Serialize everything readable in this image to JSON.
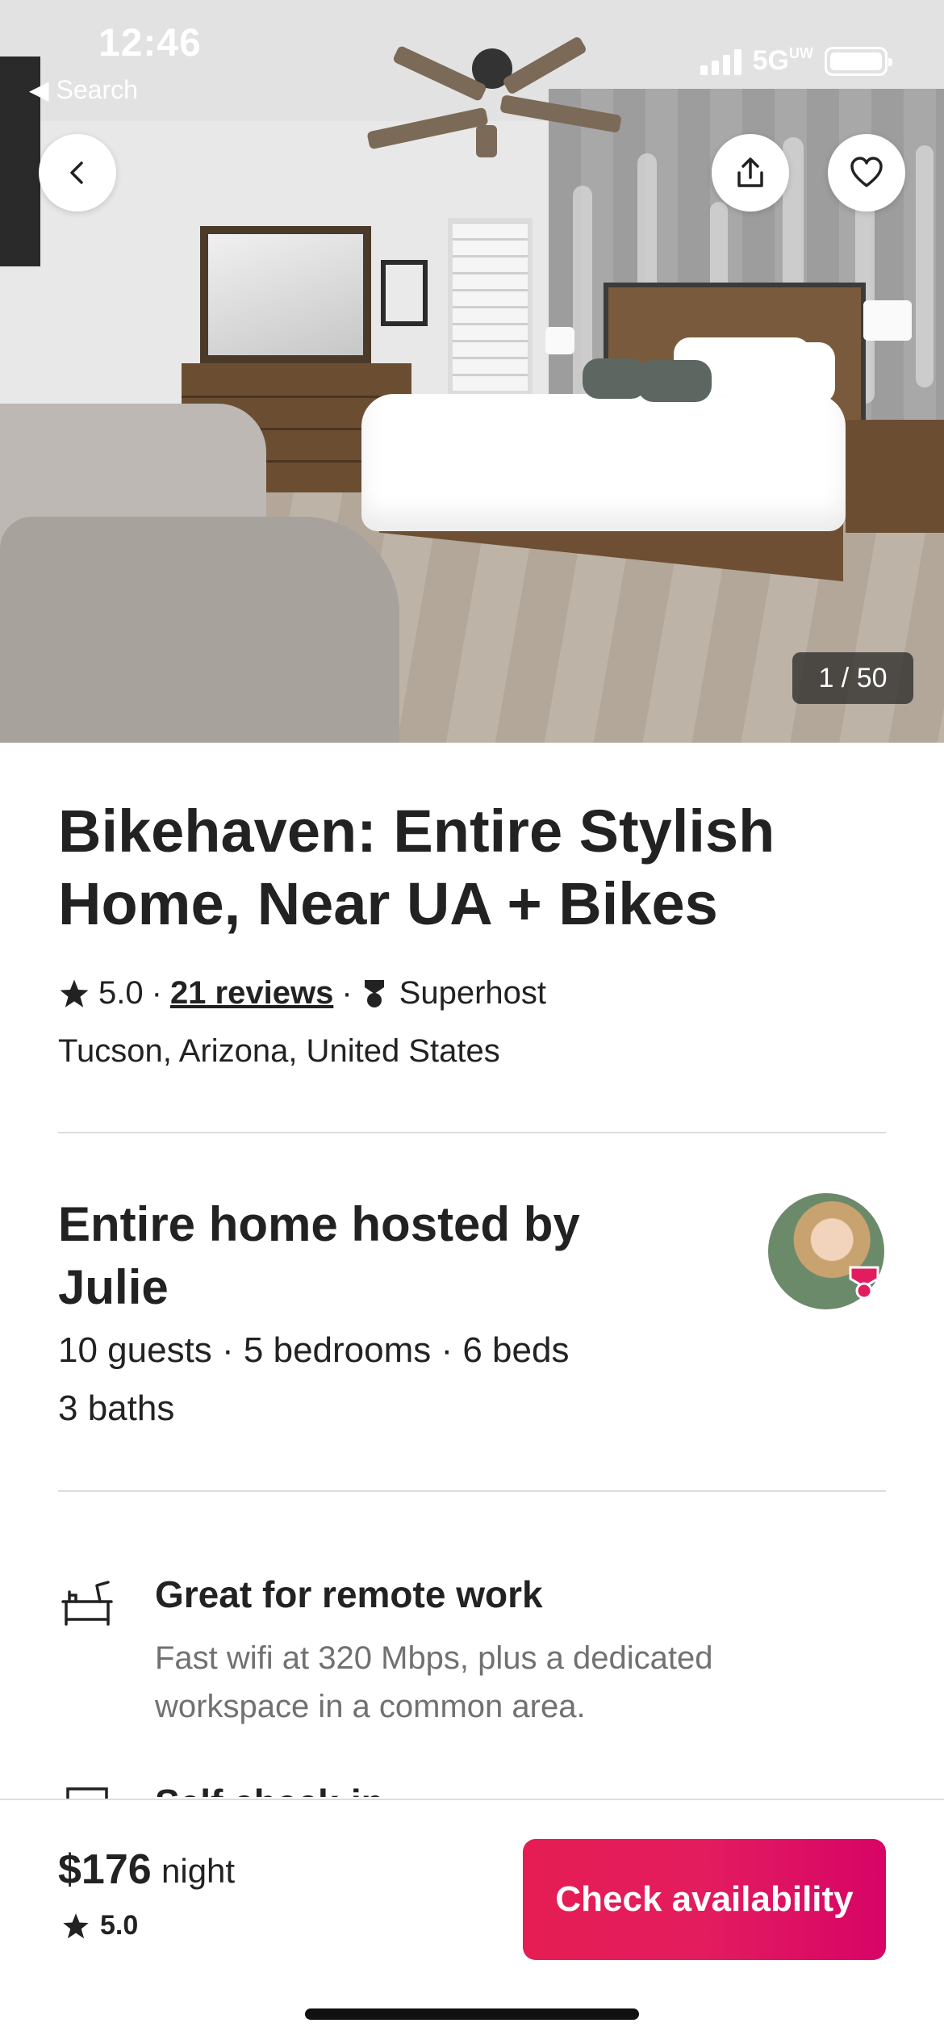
{
  "status_bar": {
    "time": "12:46",
    "back_label": "Search",
    "network": "5G",
    "network_suffix": "UW"
  },
  "hero": {
    "photo_counter": "1 / 50",
    "back_icon": "chevron-left-icon",
    "share_icon": "share-icon",
    "save_icon": "heart-icon"
  },
  "listing": {
    "title": "Bikehaven: Entire Stylish Home, Near UA + Bikes",
    "rating": "5.0",
    "reviews_link": "21 reviews",
    "host_badge": "Superhost",
    "location": "Tucson, Arizona, United States"
  },
  "host": {
    "title": "Entire home hosted by Julie",
    "capacity": "10 guests · 5 bedrooms · 6 beds",
    "baths": "3 baths"
  },
  "features": [
    {
      "icon": "desk-icon",
      "title": "Great for remote work",
      "description": "Fast wifi at 320 Mbps, plus a dedicated workspace in a common area."
    },
    {
      "icon": "door-icon",
      "title": "Self check-in"
    }
  ],
  "booking": {
    "price": "$176",
    "unit": "night",
    "rating": "5.0",
    "cta_label": "Check availability"
  },
  "colors": {
    "accent": "#E31C5F",
    "text": "#222222",
    "muted": "#717171",
    "divider": "#DDDDDD"
  }
}
